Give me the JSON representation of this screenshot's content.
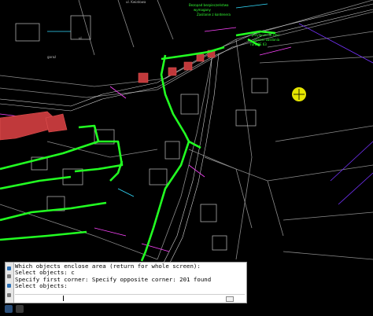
{
  "command_window": {
    "history": [
      "Which objects enclose area (return for whole screen):",
      "Select objects: c",
      "Specify first corner: Specify opposite corner: 201 found",
      "Select objects:"
    ],
    "input_value": ""
  },
  "colors": {
    "background": "#000000",
    "highlight": "#22ff22",
    "annotation_white": "#e8e8e8",
    "annotation_magenta": "#ff44ff",
    "annotation_cyan": "#33ddff",
    "building_fill": "#c0393b",
    "cursor": "#e6e600"
  },
  "icons": {
    "crosshair": "crosshair-cursor-icon",
    "gutter": "command-line-gutter-icon"
  }
}
